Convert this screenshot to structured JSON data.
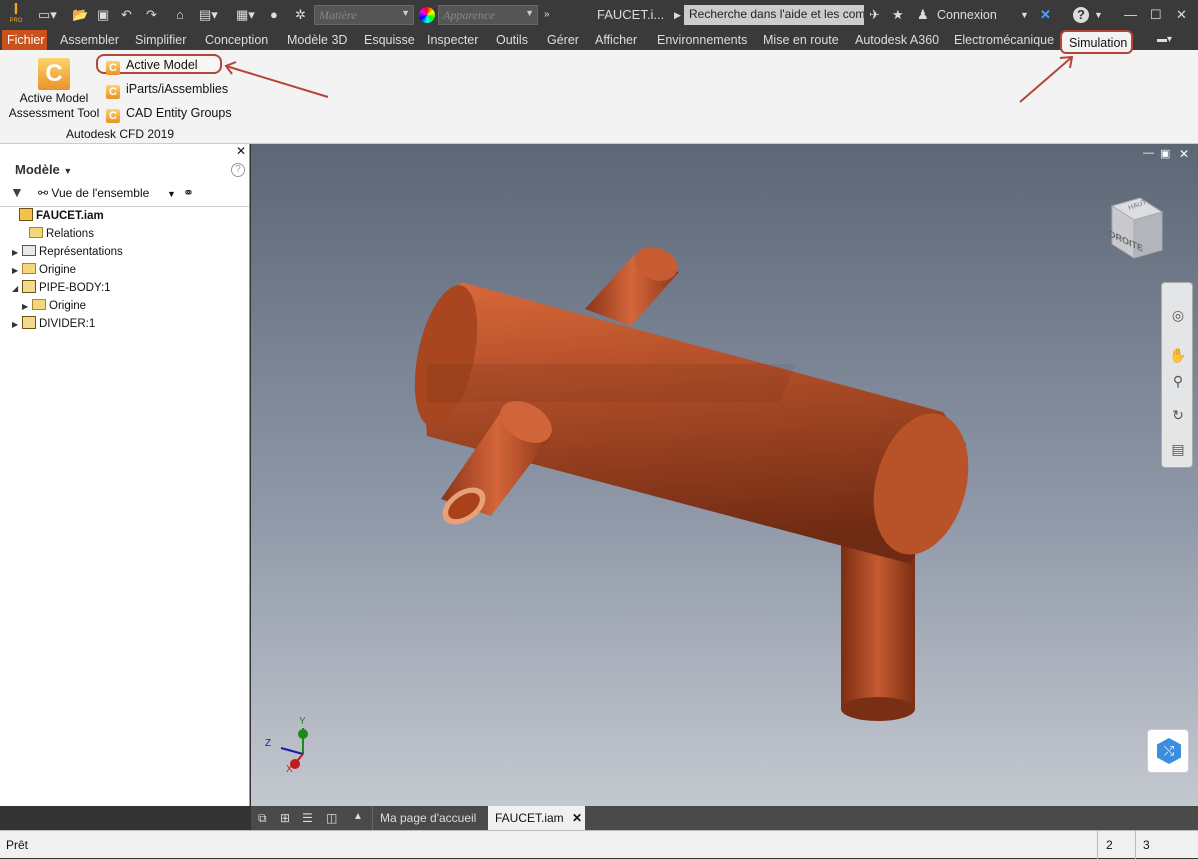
{
  "title": {
    "material_placeholder": "Matière",
    "appearance_placeholder": "Apparence",
    "file_title": "FAUCET.i...",
    "search_placeholder": "Recherche dans l'aide et les com",
    "login": "Connexion",
    "app_badge": "PRO"
  },
  "menu": {
    "items": [
      "Fichier",
      "Assembler",
      "Simplifier",
      "Conception",
      "Modèle 3D",
      "Esquisse",
      "Inspecter",
      "Outils",
      "Gérer",
      "Afficher",
      "Environnements",
      "Mise en route",
      "Autodesk A360",
      "Electromécanique",
      "Simulation"
    ]
  },
  "ribbon": {
    "big_label": "Active Model Assessment Tool",
    "items": [
      "Active Model",
      "iParts/iAssemblies",
      "CAD Entity Groups"
    ],
    "group": "Autodesk CFD 2019",
    "icon_glyph": "C"
  },
  "browser": {
    "title": "Modèle",
    "view": "Vue de l'ensemble",
    "tree": [
      "FAUCET.iam",
      "Relations",
      "Représentations",
      "Origine",
      "PIPE-BODY:1",
      "Origine",
      "DIVIDER:1"
    ]
  },
  "viewcube": {
    "face": "DROITE",
    "top": "HAUT"
  },
  "axes": {
    "x": "X",
    "y": "Y",
    "z": "Z"
  },
  "tabs": {
    "home": "Ma page d'accueil",
    "doc": "FAUCET.iam"
  },
  "status": {
    "text": "Prêt",
    "n1": "2",
    "n2": "3"
  },
  "colors": {
    "accent": "#c8511c",
    "highlight": "#b3453a",
    "model": "#b5502a"
  }
}
